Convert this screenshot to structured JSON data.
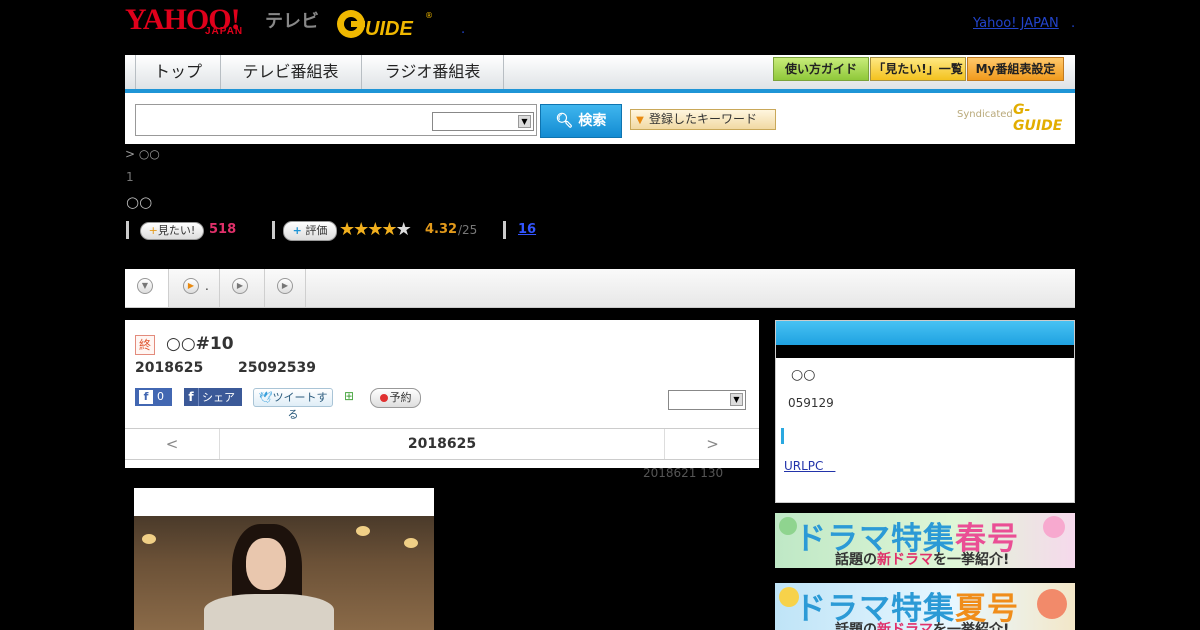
{
  "header": {
    "logo_yahoo": "YAHOO!",
    "logo_japan": "JAPAN",
    "logo_terebi": "テレビ",
    "logo_gguide": "G-GUIDE",
    "yahoo_link": "Yahoo! JAPAN",
    "dot": "."
  },
  "nav": {
    "tabs": [
      "トップ",
      "テレビ番組表",
      "ラジオ番組表"
    ],
    "buttons": [
      "使い方ガイド",
      "「見たい!」一覧",
      "My番組表設定"
    ]
  },
  "search": {
    "button_label": "検索",
    "keyword_button": "登録したキーワード",
    "syndicated": "Syndicated",
    "syndicated_brand": "G-GUIDE"
  },
  "program": {
    "breadcrumb": "> ○○",
    "episode_count": "1",
    "title_marks": "○○",
    "mitai_label": "見たい!",
    "mitai_count": "518",
    "hyoka_label": "評価",
    "rating": "4.32",
    "rating_count": "/25",
    "review_count": "16",
    "rating_stars": 4.32
  },
  "subtabs": {
    "tab2_label": "."
  },
  "detail": {
    "end_badge": "終",
    "title": "○○#10",
    "date": "2018625",
    "time": "25092539",
    "fb_like_count": "0",
    "fb_share_label": "シェア",
    "tweet_label": "ツイートする",
    "yoyaku_label": "予約",
    "date_nav_prev": "<",
    "date_nav_current": "2018625",
    "date_nav_next": ">",
    "updated": "2018621  130"
  },
  "sidebar": {
    "name": "○○",
    "number": "059129",
    "link": "URLPC　"
  },
  "banners": [
    {
      "title_a": "ドラマ特集",
      "title_b": "春号",
      "sub_a": "話題の",
      "sub_b": "新ドラマ",
      "sub_c": "を一挙紹介!"
    },
    {
      "title_a": "ドラマ特集",
      "title_b": "夏号",
      "sub_a": "話題の",
      "sub_b": "新ドラマ",
      "sub_c": "を一挙紹介!"
    }
  ],
  "colors": {
    "accent_blue": "#1f95d6",
    "yahoo_red": "#e0001b",
    "mitai_pink": "#e0306a",
    "rating_orange": "#e39a1b"
  }
}
